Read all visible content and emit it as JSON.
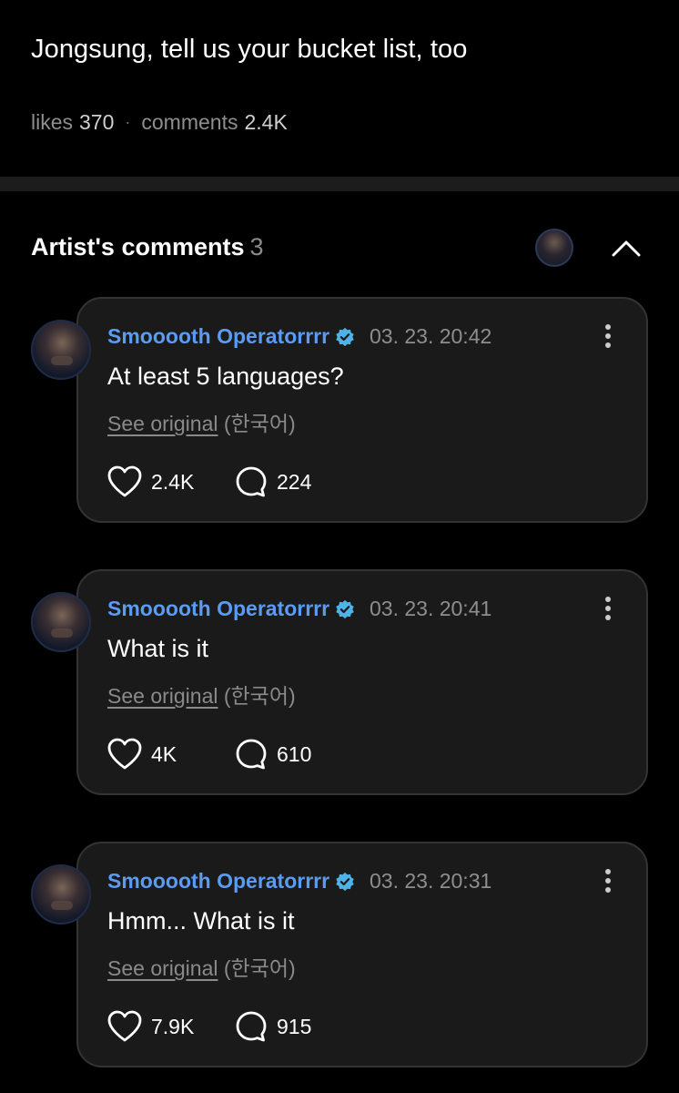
{
  "post": {
    "text": "Jongsung, tell us your bucket list, too",
    "likes_label": "likes",
    "likes_count": "370",
    "comments_label": "comments",
    "comments_count": "2.4K"
  },
  "artist_comments": {
    "title": "Artist's comments",
    "count": "3"
  },
  "comments": [
    {
      "author": "Smooooth Operatorrrr",
      "time": "03. 23. 20:42",
      "text": "At least 5 languages?",
      "see_original": "See original",
      "original_lang": "(한국어)",
      "likes": "2.4K",
      "replies": "224"
    },
    {
      "author": "Smooooth Operatorrrr",
      "time": "03. 23. 20:41",
      "text": "What is it",
      "see_original": "See original",
      "original_lang": "(한국어)",
      "likes": "4K",
      "replies": "610"
    },
    {
      "author": "Smooooth Operatorrrr",
      "time": "03. 23. 20:31",
      "text": "Hmm... What is it",
      "see_original": "See original",
      "original_lang": "(한국어)",
      "likes": "7.9K",
      "replies": "915"
    }
  ],
  "colors": {
    "author": "#5b9bf2",
    "verified_badge": "#4fb3e8",
    "card_bg": "#1a1a1a",
    "card_border": "#333333"
  },
  "icons": [
    "verified-badge-icon",
    "more-vertical-icon",
    "heart-icon",
    "comment-bubble-icon",
    "chevron-up-icon"
  ]
}
